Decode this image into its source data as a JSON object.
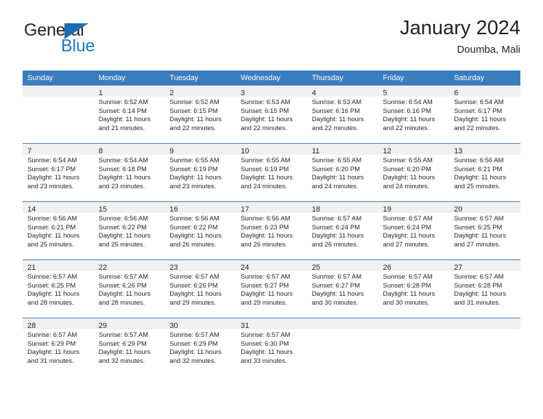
{
  "brand": {
    "name_part1": "General",
    "name_part2": "Blue",
    "triangle_color": "#1b6cb0",
    "blue_color": "#1d78bf"
  },
  "header": {
    "title": "January 2024",
    "subtitle": "Doumba, Mali"
  },
  "theme": {
    "header_bg": "#3a7dbf",
    "daynum_bg": "#f0f0f0",
    "text": "#231f20"
  },
  "weekday_headers": [
    "Sunday",
    "Monday",
    "Tuesday",
    "Wednesday",
    "Thursday",
    "Friday",
    "Saturday"
  ],
  "labels": {
    "sunrise_prefix": "Sunrise: ",
    "sunset_prefix": "Sunset: ",
    "daylight_prefix": "Daylight: "
  },
  "weeks": [
    [
      {
        "day": "",
        "sunrise": "",
        "sunset": "",
        "daylight": "",
        "empty": true
      },
      {
        "day": "1",
        "sunrise": "Sunrise: 6:52 AM",
        "sunset": "Sunset: 6:14 PM",
        "daylight": "Daylight: 11 hours and 21 minutes."
      },
      {
        "day": "2",
        "sunrise": "Sunrise: 6:52 AM",
        "sunset": "Sunset: 6:15 PM",
        "daylight": "Daylight: 11 hours and 22 minutes."
      },
      {
        "day": "3",
        "sunrise": "Sunrise: 6:53 AM",
        "sunset": "Sunset: 6:15 PM",
        "daylight": "Daylight: 11 hours and 22 minutes."
      },
      {
        "day": "4",
        "sunrise": "Sunrise: 6:53 AM",
        "sunset": "Sunset: 6:16 PM",
        "daylight": "Daylight: 11 hours and 22 minutes."
      },
      {
        "day": "5",
        "sunrise": "Sunrise: 6:54 AM",
        "sunset": "Sunset: 6:16 PM",
        "daylight": "Daylight: 11 hours and 22 minutes."
      },
      {
        "day": "6",
        "sunrise": "Sunrise: 6:54 AM",
        "sunset": "Sunset: 6:17 PM",
        "daylight": "Daylight: 11 hours and 22 minutes."
      }
    ],
    [
      {
        "day": "7",
        "sunrise": "Sunrise: 6:54 AM",
        "sunset": "Sunset: 6:17 PM",
        "daylight": "Daylight: 11 hours and 23 minutes."
      },
      {
        "day": "8",
        "sunrise": "Sunrise: 6:54 AM",
        "sunset": "Sunset: 6:18 PM",
        "daylight": "Daylight: 11 hours and 23 minutes."
      },
      {
        "day": "9",
        "sunrise": "Sunrise: 6:55 AM",
        "sunset": "Sunset: 6:19 PM",
        "daylight": "Daylight: 11 hours and 23 minutes."
      },
      {
        "day": "10",
        "sunrise": "Sunrise: 6:55 AM",
        "sunset": "Sunset: 6:19 PM",
        "daylight": "Daylight: 11 hours and 24 minutes."
      },
      {
        "day": "11",
        "sunrise": "Sunrise: 6:55 AM",
        "sunset": "Sunset: 6:20 PM",
        "daylight": "Daylight: 11 hours and 24 minutes."
      },
      {
        "day": "12",
        "sunrise": "Sunrise: 6:55 AM",
        "sunset": "Sunset: 6:20 PM",
        "daylight": "Daylight: 11 hours and 24 minutes."
      },
      {
        "day": "13",
        "sunrise": "Sunrise: 6:56 AM",
        "sunset": "Sunset: 6:21 PM",
        "daylight": "Daylight: 11 hours and 25 minutes."
      }
    ],
    [
      {
        "day": "14",
        "sunrise": "Sunrise: 6:56 AM",
        "sunset": "Sunset: 6:21 PM",
        "daylight": "Daylight: 11 hours and 25 minutes."
      },
      {
        "day": "15",
        "sunrise": "Sunrise: 6:56 AM",
        "sunset": "Sunset: 6:22 PM",
        "daylight": "Daylight: 11 hours and 25 minutes."
      },
      {
        "day": "16",
        "sunrise": "Sunrise: 6:56 AM",
        "sunset": "Sunset: 6:22 PM",
        "daylight": "Daylight: 11 hours and 26 minutes."
      },
      {
        "day": "17",
        "sunrise": "Sunrise: 6:56 AM",
        "sunset": "Sunset: 6:23 PM",
        "daylight": "Daylight: 11 hours and 26 minutes."
      },
      {
        "day": "18",
        "sunrise": "Sunrise: 6:57 AM",
        "sunset": "Sunset: 6:24 PM",
        "daylight": "Daylight: 11 hours and 26 minutes."
      },
      {
        "day": "19",
        "sunrise": "Sunrise: 6:57 AM",
        "sunset": "Sunset: 6:24 PM",
        "daylight": "Daylight: 11 hours and 27 minutes."
      },
      {
        "day": "20",
        "sunrise": "Sunrise: 6:57 AM",
        "sunset": "Sunset: 6:25 PM",
        "daylight": "Daylight: 11 hours and 27 minutes."
      }
    ],
    [
      {
        "day": "21",
        "sunrise": "Sunrise: 6:57 AM",
        "sunset": "Sunset: 6:25 PM",
        "daylight": "Daylight: 11 hours and 28 minutes."
      },
      {
        "day": "22",
        "sunrise": "Sunrise: 6:57 AM",
        "sunset": "Sunset: 6:26 PM",
        "daylight": "Daylight: 11 hours and 28 minutes."
      },
      {
        "day": "23",
        "sunrise": "Sunrise: 6:57 AM",
        "sunset": "Sunset: 6:26 PM",
        "daylight": "Daylight: 11 hours and 29 minutes."
      },
      {
        "day": "24",
        "sunrise": "Sunrise: 6:57 AM",
        "sunset": "Sunset: 6:27 PM",
        "daylight": "Daylight: 11 hours and 29 minutes."
      },
      {
        "day": "25",
        "sunrise": "Sunrise: 6:57 AM",
        "sunset": "Sunset: 6:27 PM",
        "daylight": "Daylight: 11 hours and 30 minutes."
      },
      {
        "day": "26",
        "sunrise": "Sunrise: 6:57 AM",
        "sunset": "Sunset: 6:28 PM",
        "daylight": "Daylight: 11 hours and 30 minutes."
      },
      {
        "day": "27",
        "sunrise": "Sunrise: 6:57 AM",
        "sunset": "Sunset: 6:28 PM",
        "daylight": "Daylight: 11 hours and 31 minutes."
      }
    ],
    [
      {
        "day": "28",
        "sunrise": "Sunrise: 6:57 AM",
        "sunset": "Sunset: 6:29 PM",
        "daylight": "Daylight: 11 hours and 31 minutes."
      },
      {
        "day": "29",
        "sunrise": "Sunrise: 6:57 AM",
        "sunset": "Sunset: 6:29 PM",
        "daylight": "Daylight: 11 hours and 32 minutes."
      },
      {
        "day": "30",
        "sunrise": "Sunrise: 6:57 AM",
        "sunset": "Sunset: 6:29 PM",
        "daylight": "Daylight: 11 hours and 32 minutes."
      },
      {
        "day": "31",
        "sunrise": "Sunrise: 6:57 AM",
        "sunset": "Sunset: 6:30 PM",
        "daylight": "Daylight: 11 hours and 33 minutes."
      },
      {
        "day": "",
        "sunrise": "",
        "sunset": "",
        "daylight": "",
        "empty": true
      },
      {
        "day": "",
        "sunrise": "",
        "sunset": "",
        "daylight": "",
        "empty": true
      },
      {
        "day": "",
        "sunrise": "",
        "sunset": "",
        "daylight": "",
        "empty": true
      }
    ]
  ]
}
